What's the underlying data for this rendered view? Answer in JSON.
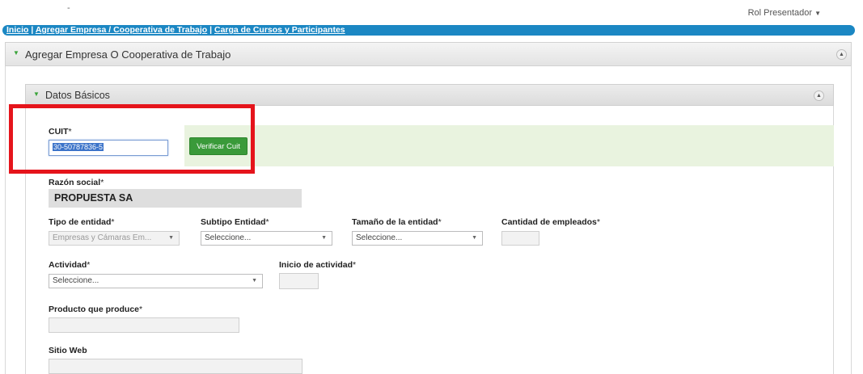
{
  "top": {
    "dash": "-",
    "role_label": "Rol Presentador"
  },
  "breadcrumb": [
    {
      "label": "Inicio"
    },
    {
      "label": "Agregar Empresa / Cooperativa de Trabajo"
    },
    {
      "label": "Carga de Cursos y Participantes"
    }
  ],
  "outer_panel": {
    "title": "Agregar Empresa O Cooperativa de Trabajo"
  },
  "inner_panel": {
    "title": "Datos Básicos"
  },
  "form": {
    "cuit": {
      "label": "CUIT",
      "value": "30-50787836-5"
    },
    "verify_button": "Verificar Cuit",
    "razon_social": {
      "label": "Razón social",
      "value": "PROPUESTA SA"
    },
    "tipo_entidad": {
      "label": "Tipo de entidad",
      "value": "Empresas y Cámaras Em..."
    },
    "subtipo_entidad": {
      "label": "Subtipo Entidad",
      "value": "Seleccione..."
    },
    "tamano_entidad": {
      "label": "Tamaño de la entidad",
      "value": "Seleccione..."
    },
    "cantidad_empleados": {
      "label": "Cantidad de empleados",
      "value": ""
    },
    "actividad": {
      "label": "Actividad",
      "value": "Seleccione..."
    },
    "inicio_actividad": {
      "label": "Inicio de actividad",
      "value": ""
    },
    "producto": {
      "label": "Producto que produce",
      "value": ""
    },
    "sitio_web": {
      "label": "Sitio Web",
      "value": ""
    }
  },
  "required_mark": "*",
  "icons": {
    "expand": "triangle-down-icon",
    "collapse": "chevron-up-icon",
    "dropdown": "caret-down-icon"
  },
  "colors": {
    "breadcrumb_bg": "#1b87c3",
    "verify_button": "#3a9a3a",
    "highlight_border": "#e5141b",
    "verify_band": "#e9f3df"
  }
}
